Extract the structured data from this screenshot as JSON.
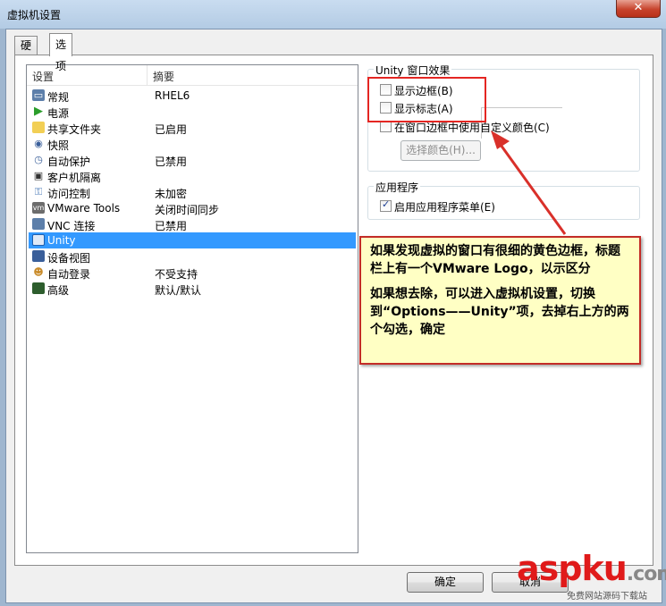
{
  "window": {
    "title": "虚拟机设置",
    "close_glyph": "✕"
  },
  "tabs": [
    {
      "label": "硬件"
    },
    {
      "label": "选项"
    }
  ],
  "settings_list": {
    "header": {
      "setting": "设置",
      "summary": "摘要"
    },
    "rows": [
      {
        "name": "常规",
        "summary": "RHEL6",
        "icon": "monitor-icon"
      },
      {
        "name": "电源",
        "summary": "",
        "icon": "play-icon"
      },
      {
        "name": "共享文件夹",
        "summary": "已启用",
        "icon": "folder-shield-icon"
      },
      {
        "name": "快照",
        "summary": "",
        "icon": "snapshot-icon"
      },
      {
        "name": "自动保护",
        "summary": "已禁用",
        "icon": "clock-icon"
      },
      {
        "name": "客户机隔离",
        "summary": "",
        "icon": "lock-icon"
      },
      {
        "name": "访问控制",
        "summary": "未加密",
        "icon": "access-icon"
      },
      {
        "name": "VMware Tools",
        "summary": "关闭时间同步",
        "icon": "vm-icon"
      },
      {
        "name": "VNC 连接",
        "summary": "已禁用",
        "icon": "vnc-icon"
      },
      {
        "name": "Unity",
        "summary": "",
        "icon": "unity-icon",
        "selected": true
      },
      {
        "name": "设备视图",
        "summary": "",
        "icon": "device-view-icon"
      },
      {
        "name": "自动登录",
        "summary": "不受支持",
        "icon": "users-icon"
      },
      {
        "name": "高级",
        "summary": "默认/默认",
        "icon": "chart-icon"
      }
    ]
  },
  "unity_group": {
    "title": "Unity 窗口效果",
    "show_borders": {
      "label": "显示边框(B)",
      "checked": false
    },
    "show_badges": {
      "label": "显示标志(A)",
      "checked": false
    },
    "custom_color": {
      "label": "在窗口边框中使用自定义颜色(C)",
      "checked": false
    },
    "choose_color_button": "选择颜色(H)..."
  },
  "applications_group": {
    "title": "应用程序",
    "enable_menu": {
      "label": "启用应用程序菜单(E)",
      "checked": true
    }
  },
  "annotation": {
    "paragraph1": "如果发现虚拟的窗口有很细的黄色边框，标题栏上有一个VMware Logo，以示区分",
    "paragraph2": "如果想去除，可以进入虚拟机设置，切换到“Options——Unity”项，去掉右上方的两个勾选，确定"
  },
  "buttons": {
    "ok": "确定",
    "cancel": "取消"
  },
  "watermark": {
    "logo": "aspku",
    "logo_suffix": ".com",
    "tagline": "免费网站源码下载站"
  },
  "colors": {
    "selection": "#3399ff",
    "annotation_bg": "#ffffc4",
    "highlight_red": "#e42622"
  }
}
